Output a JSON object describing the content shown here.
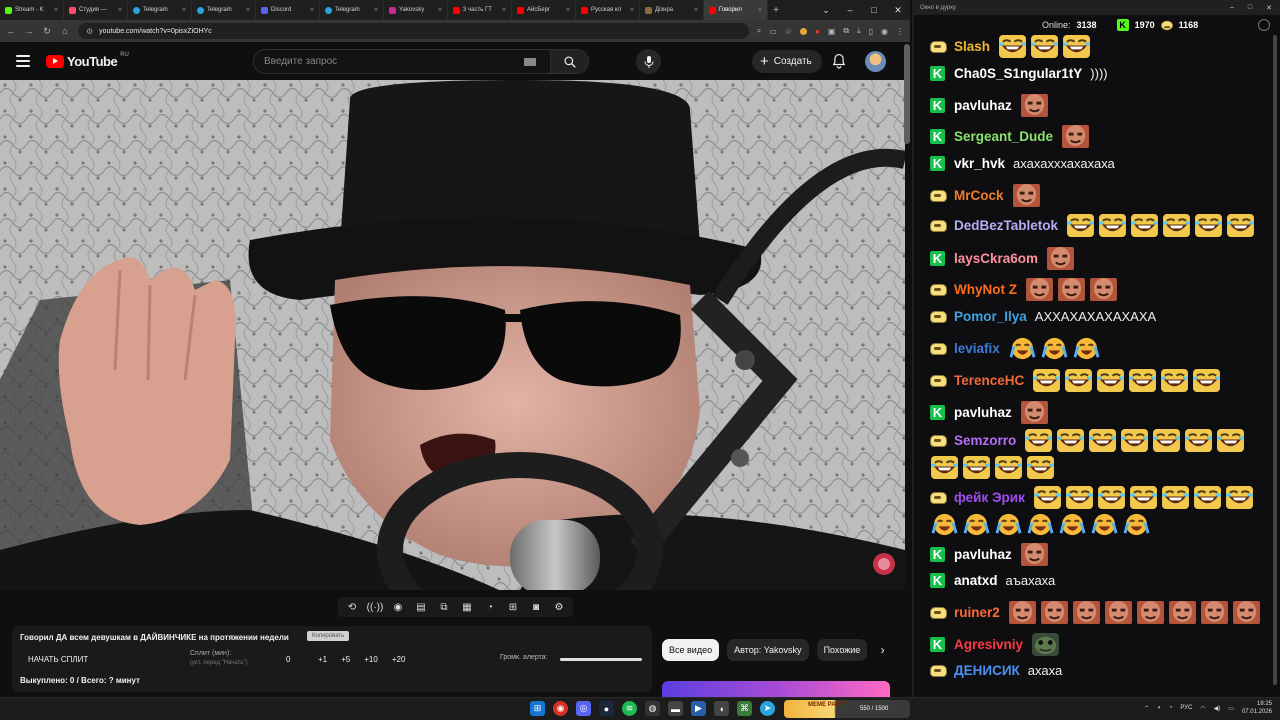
{
  "browser": {
    "tabs": [
      {
        "label": "Stream - K",
        "color": "#53fc18"
      },
      {
        "label": "Студия —",
        "color": "#ff4d6d"
      },
      {
        "label": "Telegram",
        "color": "#2aa3e0"
      },
      {
        "label": "Telegram",
        "color": "#2aa3e0"
      },
      {
        "label": "Discord",
        "color": "#5865f2"
      },
      {
        "label": "Telegram",
        "color": "#2aa3e0"
      },
      {
        "label": "Yakovsky",
        "color": "#c52a8c"
      },
      {
        "label": "3 часть ГТ",
        "color": "#ff0000"
      },
      {
        "label": "АйсБерг",
        "color": "#ff0000"
      },
      {
        "label": "Русская кл",
        "color": "#ff0000"
      },
      {
        "label": "Дізнра",
        "color": "#8a6d3b"
      },
      {
        "label": "Говорил",
        "color": "#ff0000"
      }
    ],
    "url": "youtube.com/watch?v=0pisxZiOHYc"
  },
  "youtube": {
    "logo_text": "YouTube",
    "region": "RU",
    "search_placeholder": "Введите запрос",
    "create_label": "Создать"
  },
  "extension": {
    "video_title": "Говорил ДА всем девушкам в ДАЙВИНЧИКЕ на протяжении недели",
    "copy_label": "Копировать",
    "start_split": "НАЧАТЬ СПЛИТ",
    "split_label": "Сплит (мин):",
    "split_note": "(уст. перед \"Начать\")",
    "split_value": "0",
    "increments": [
      "+1",
      "+5",
      "+10",
      "+20"
    ],
    "alert_volume_label": "Громк. алерта:",
    "bought_line": "Выкуплено: 0 / Всего: ? минут"
  },
  "chips": {
    "all": "Все видео",
    "author": "Автор: Yakovsky",
    "similar": "Похожие"
  },
  "chat": {
    "window_title": "Окно в дурку",
    "online_label": "Online:",
    "online_count": "3138",
    "kick_count": "1970",
    "pepe_count": "1168",
    "messages": [
      {
        "user": "Slash",
        "text": ""
      },
      {
        "user": "Cha0S_S1ngular1tY",
        "text": "))))"
      },
      {
        "user": "pavluhaz",
        "text": ""
      },
      {
        "user": "Sergeant_Dude",
        "text": ""
      },
      {
        "user": "vkr_hvk",
        "text": "ахахахххахахаха"
      },
      {
        "user": "MrCock",
        "text": ""
      },
      {
        "user": "DedBezTabletok",
        "text": ""
      },
      {
        "user": "laysCkra6om",
        "text": ""
      },
      {
        "user": "WhyNot Z",
        "text": ""
      },
      {
        "user": "Pomor_Ilya",
        "text": "АХХАХАХАХАХАХА"
      },
      {
        "user": "leviafix",
        "text": ""
      },
      {
        "user": "TerenceHC",
        "text": ""
      },
      {
        "user": "pavluhaz",
        "text": ""
      },
      {
        "user": "Semzorro",
        "text": ""
      },
      {
        "user": "фейк Эрик",
        "text": ""
      },
      {
        "user": "pavluhaz",
        "text": ""
      },
      {
        "user": "anatxd",
        "text": "аъахаха"
      },
      {
        "user": "ruiner2",
        "text": ""
      },
      {
        "user": "Agresivniy",
        "text": ""
      },
      {
        "user": "ДЕНИСИК",
        "text": "ахаха"
      }
    ]
  },
  "taskbar": {
    "promo_text": "MEME PARTY",
    "promo_counter": "550 / 1500",
    "lang": "РУС",
    "time": "18:25",
    "date": "07.01.2026"
  }
}
